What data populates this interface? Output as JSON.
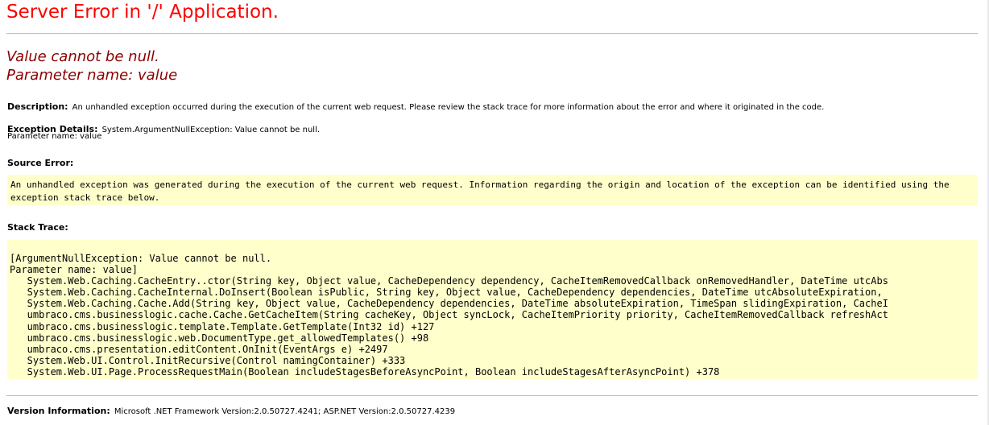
{
  "page": {
    "title": "Server Error in '/' Application.",
    "error_message_line1": "Value cannot be null.",
    "error_message_line2": "Parameter name: value",
    "description_label": "Description:",
    "description_text": "An unhandled exception occurred during the execution of the current web request. Please review the stack trace for more information about the error and where it originated in the code.",
    "exception_label": "Exception Details:",
    "exception_text": "System.ArgumentNullException: Value cannot be null.",
    "exception_param": "Parameter name: value",
    "source_error_label": "Source Error:",
    "source_error_text": "An unhandled exception was generated during the execution of the current web request. Information regarding the origin and location of the exception can be identified using the exception stack trace below.",
    "stack_trace_label": "Stack Trace:",
    "stack_trace_lines": [
      "[ArgumentNullException: Value cannot be null.",
      "Parameter name: value]",
      "   System.Web.Caching.CacheEntry..ctor(String key, Object value, CacheDependency dependency, CacheItemRemovedCallback onRemovedHandler, DateTime utcAbs",
      "   System.Web.Caching.CacheInternal.DoInsert(Boolean isPublic, String key, Object value, CacheDependency dependencies, DateTime utcAbsoluteExpiration, ",
      "   System.Web.Caching.Cache.Add(String key, Object value, CacheDependency dependencies, DateTime absoluteExpiration, TimeSpan slidingExpiration, CacheI",
      "   umbraco.cms.businesslogic.cache.Cache.GetCacheItem(String cacheKey, Object syncLock, CacheItemPriority priority, CacheItemRemovedCallback refreshAct",
      "   umbraco.cms.businesslogic.template.Template.GetTemplate(Int32 id) +127",
      "   umbraco.cms.businesslogic.web.DocumentType.get_allowedTemplates() +98",
      "   umbraco.cms.presentation.editContent.OnInit(EventArgs e) +2497",
      "   System.Web.UI.Control.InitRecursive(Control namingContainer) +333",
      "   System.Web.UI.Page.ProcessRequestMain(Boolean includeStagesBeforeAsyncPoint, Boolean includeStagesAfterAsyncPoint) +378"
    ],
    "version_label": "Version Information:",
    "version_text": "Microsoft .NET Framework Version:2.0.50727.4241; ASP.NET Version:2.0.50727.4239"
  },
  "colors": {
    "title": "#ff0000",
    "error_message": "#8b0000",
    "code_background": "#ffffcc",
    "rule": "#c0c0c0"
  }
}
